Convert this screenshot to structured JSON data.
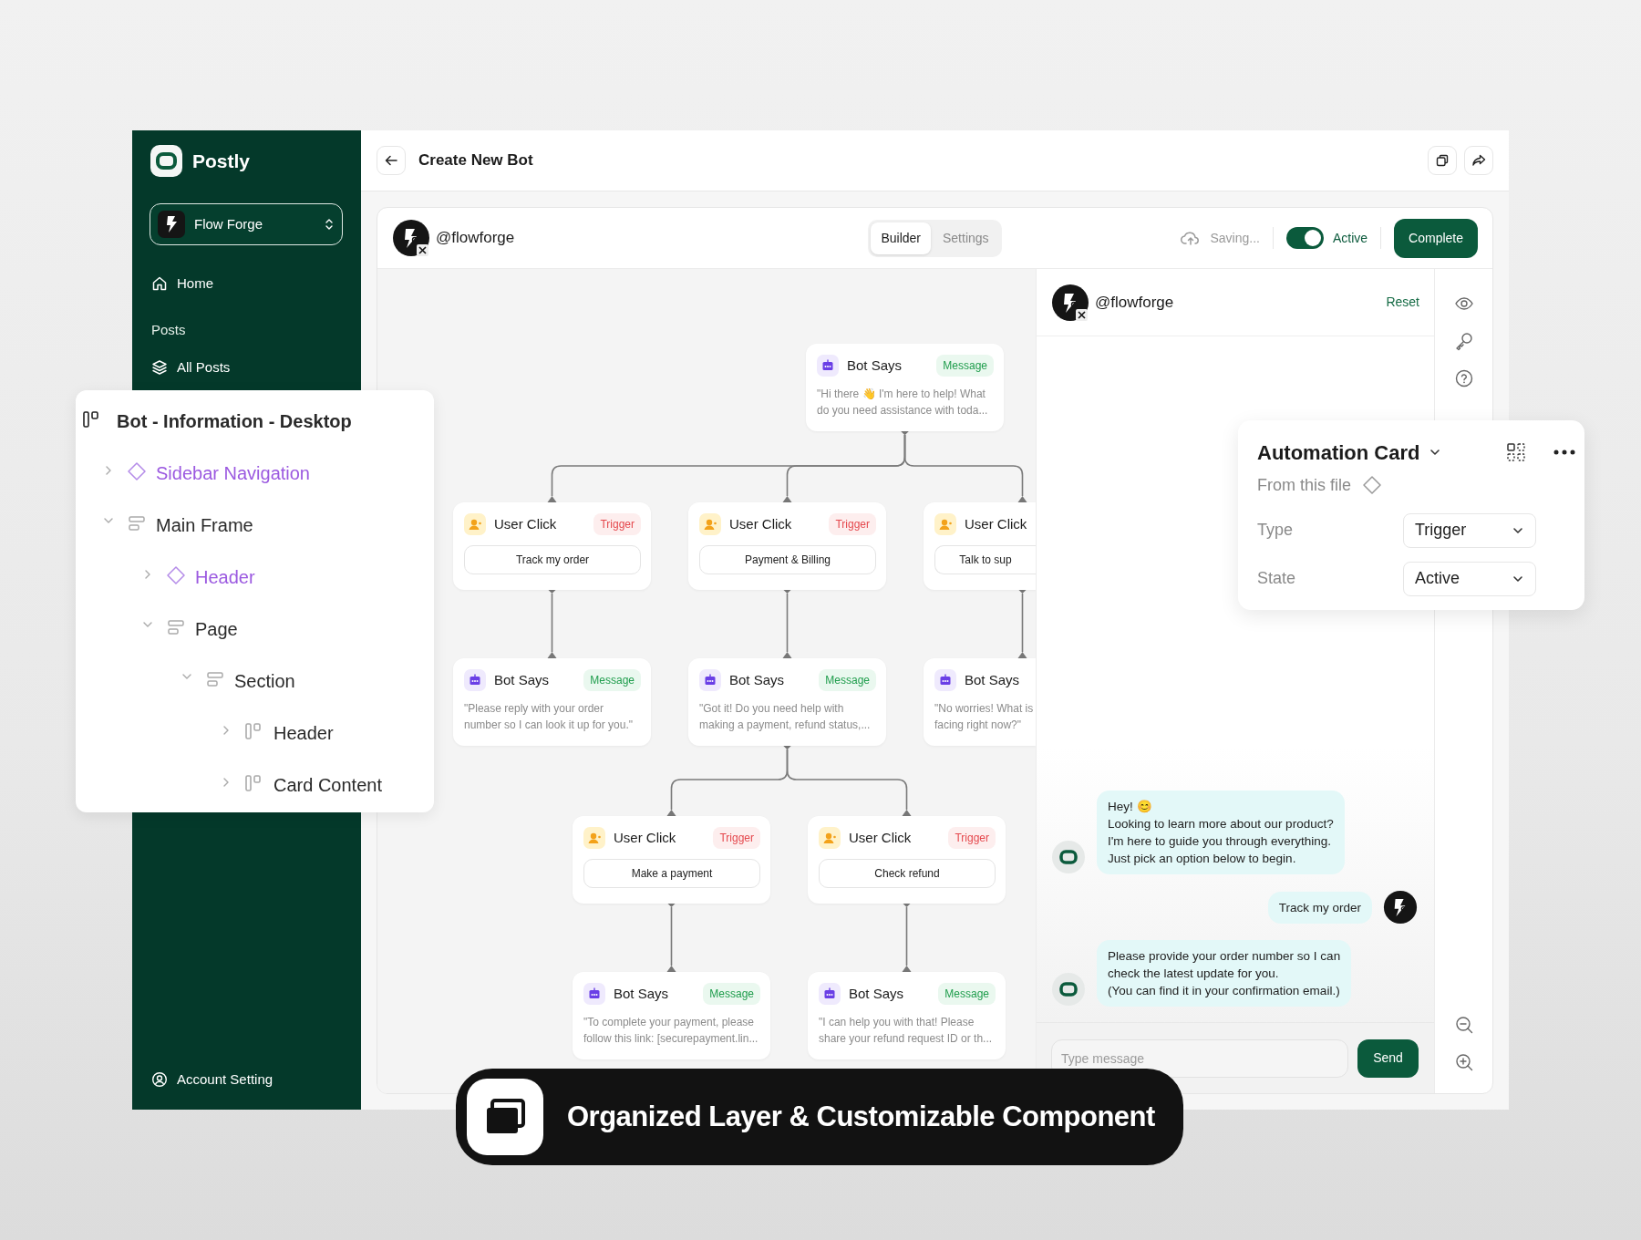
{
  "sidebar": {
    "brand": "Postly",
    "workspace": "Flow Forge",
    "items": [
      {
        "kind": "link",
        "label": "Home"
      },
      {
        "kind": "heading",
        "label": "Posts"
      },
      {
        "kind": "link",
        "label": "All Posts"
      }
    ],
    "footer": "Account Setting"
  },
  "header": {
    "title": "Create New Bot"
  },
  "builder": {
    "account": "@flowforge",
    "tabs": [
      {
        "label": "Builder",
        "selected": true
      },
      {
        "label": "Settings",
        "selected": false
      }
    ],
    "save_status": "Saving...",
    "status_toggle": {
      "label": "Active",
      "on": true
    },
    "primary_button": "Complete"
  },
  "flow": {
    "kind": "message",
    "title": "Bot Says",
    "badge": "Message",
    "text": "\"Hi there 👋 I'm here to help! What do you need assistance with toda...",
    "children": [
      {
        "kind": "trigger",
        "title": "User Click",
        "badge": "Trigger",
        "option": "Track my order",
        "children": [
          {
            "kind": "message",
            "title": "Bot Says",
            "badge": "Message",
            "text": "\"Please reply with your order number so I can look it up for you.\""
          }
        ]
      },
      {
        "kind": "trigger",
        "title": "User Click",
        "badge": "Trigger",
        "option": "Payment & Billing",
        "children": [
          {
            "kind": "message",
            "title": "Bot Says",
            "badge": "Message",
            "text": "\"Got it! Do you need help with making a payment, refund status,...",
            "children": [
              {
                "kind": "trigger",
                "title": "User Click",
                "badge": "Trigger",
                "option": "Make a payment",
                "children": [
                  {
                    "kind": "message",
                    "title": "Bot Says",
                    "badge": "Message",
                    "text": "\"To complete your payment, please follow this link: [securepayment.lin..."
                  }
                ]
              },
              {
                "kind": "trigger",
                "title": "User Click",
                "badge": "Trigger",
                "option": "Check refund",
                "children": [
                  {
                    "kind": "message",
                    "title": "Bot Says",
                    "badge": "Message",
                    "text": "\"I can help you with that! Please share your refund request ID or th..."
                  }
                ]
              }
            ]
          }
        ]
      },
      {
        "kind": "trigger",
        "title": "User Click",
        "option": "Talk to sup",
        "children": [
          {
            "kind": "message",
            "title": "Bot Says",
            "text": "\"No worries! What is facing right now?\""
          }
        ]
      }
    ]
  },
  "preview": {
    "account": "@flowforge",
    "reset": "Reset",
    "messages": [
      {
        "kind": "bot",
        "text": "Hey! 😊\nLooking to learn more about our product?\nI'm here to guide you through everything.\nJust pick an option below to begin."
      },
      {
        "kind": "user",
        "text": "Track my order"
      },
      {
        "kind": "bot",
        "text": "Please provide your order number so I can\ncheck the latest update for you.\n(You can find it in your confirmation email.)"
      }
    ],
    "input": {
      "placeholder": "Type message"
    },
    "send": "Send"
  },
  "layers": {
    "kind": "frame",
    "label": "Bot - Information - Desktop",
    "children": [
      {
        "kind": "component",
        "label": "Sidebar Navigation",
        "expanded": false
      },
      {
        "kind": "stack",
        "label": "Main Frame",
        "expanded": true,
        "children": [
          {
            "kind": "component",
            "label": "Header",
            "expanded": false
          },
          {
            "kind": "stack",
            "label": "Page",
            "expanded": true,
            "children": [
              {
                "kind": "stack",
                "label": "Section",
                "expanded": true,
                "children": [
                  {
                    "kind": "frame",
                    "label": "Header",
                    "expanded": false
                  },
                  {
                    "kind": "frame",
                    "label": "Card Content",
                    "expanded": false
                  }
                ]
              }
            ]
          }
        ]
      }
    ]
  },
  "automation_card": {
    "title": "Automation Card",
    "source": "From this file",
    "fields": [
      {
        "label": "Type",
        "value": "Trigger"
      },
      {
        "label": "State",
        "value": "Active"
      }
    ]
  },
  "caption": "Organized Layer & Customizable Component"
}
